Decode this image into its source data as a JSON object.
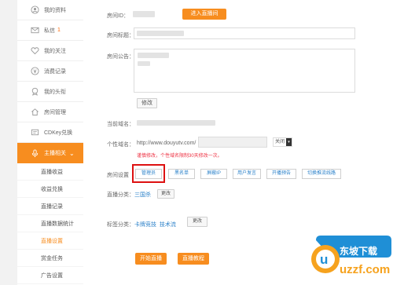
{
  "sidebar": {
    "items": [
      {
        "label": "我的资料",
        "icon": "user-circle-icon"
      },
      {
        "label": "私信",
        "badge": "1",
        "icon": "mail-icon"
      },
      {
        "label": "我的关注",
        "icon": "heart-icon"
      },
      {
        "label": "消费记录",
        "icon": "coin-icon"
      },
      {
        "label": "我的头衔",
        "icon": "badge-icon"
      },
      {
        "label": "房间管理",
        "icon": "house-icon"
      },
      {
        "label": "CDKey兑换",
        "icon": "key-icon"
      }
    ],
    "active_section": {
      "label": "主播相关",
      "icon": "microphone-icon",
      "chevron": "⌄"
    },
    "sub_items": [
      "直播收益",
      "收益兑换",
      "直播记录",
      "直播数据统计",
      "直播设置",
      "赏金任务",
      "广告设置"
    ]
  },
  "main": {
    "room_id_label": "房间ID：",
    "enter_room_button": "进入直播间",
    "room_title_label": "房间标题：",
    "room_notice_label": "房间公告：",
    "edit_notice_button": "修改",
    "domain_label": "当前域名：",
    "custom_domain_label": "个性域名：",
    "custom_domain_prefix": "http://www.douyutv.com/",
    "custom_domain_select": "关闭",
    "custom_domain_warning": "谨慎修改，个性域名限制30天修改一次。",
    "room_settings_label": "房间设置",
    "settings_tabs": [
      "管理员",
      "黑名单",
      "屏蔽IP",
      "用户发言",
      "开播预告",
      "切换推流线路"
    ],
    "category_label": "直播分类：",
    "category_value": "三国杀",
    "category_edit_button": "更改",
    "tags_label": "标签分类：",
    "tags": [
      "卡牌竞技",
      "技术流"
    ],
    "tags_edit_button": "更改",
    "start_live_button": "开始直播",
    "tutorial_button": "直播教程"
  },
  "watermark": {
    "text": "uzzf.com",
    "cn_text": "东坡下载"
  },
  "colors": {
    "accent": "#f78d1f",
    "link": "#2a80c9",
    "warning": "#ee3344",
    "highlight_box": "#dd1111"
  }
}
